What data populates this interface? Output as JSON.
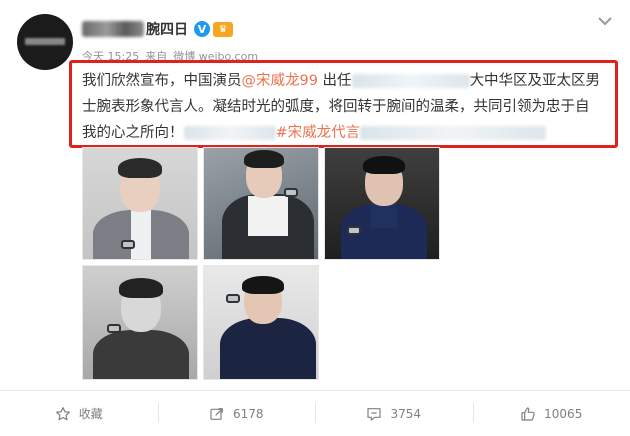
{
  "post": {
    "username_visible": "A        腕四日",
    "username_tail": "腕四日",
    "meta": {
      "time": "今天 15:25",
      "from_label": "来自",
      "source": "微博 weibo.com"
    },
    "text": {
      "line1_pre": "我们欣然宣布，中国演员",
      "mention": "@宋威龙99",
      "line1_mid": " 出任",
      "line1_post": "大中华区及亚太区男",
      "line2": "士腕表形象代言人。凝结时光的弧度，将回转于腕间的温柔，共同引领为忠于自",
      "line3_pre": "我的心之所向！",
      "hashtag": "#宋威龙代言",
      "line3_post": ""
    }
  },
  "icons": {
    "verified": "verified-v-icon",
    "vip": "vip-crown-icon",
    "menu": "chevron-down-icon",
    "favorite": "star-icon",
    "repost": "repost-icon",
    "comment": "comment-icon",
    "like": "thumbs-up-icon"
  },
  "toolbar": {
    "favorite_label": "收藏",
    "repost_count": "6178",
    "comment_count": "3754",
    "like_count": "10065"
  },
  "colors": {
    "highlight_box": "#e0221d",
    "link": "#eb7350",
    "verified": "#1d9bf0",
    "muted": "#939393"
  }
}
